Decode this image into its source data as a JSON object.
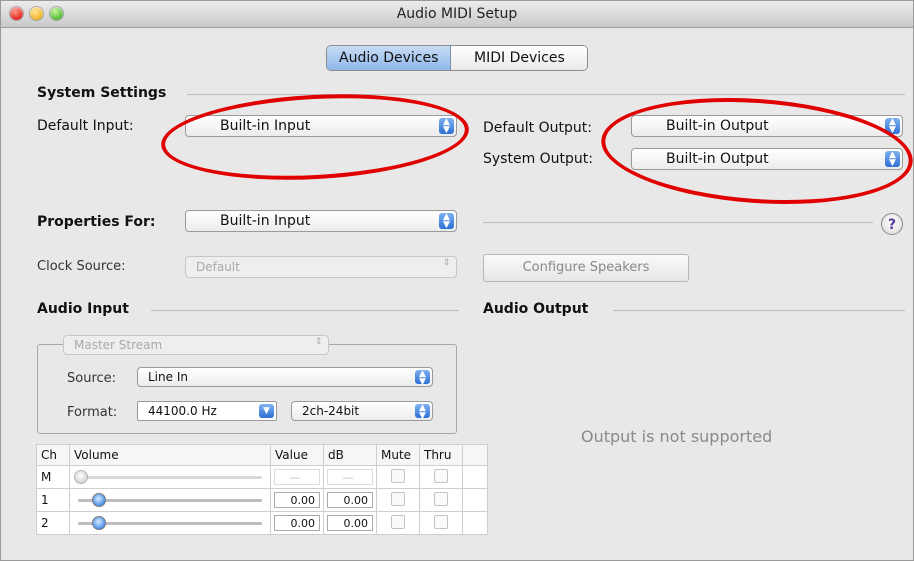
{
  "window": {
    "title": "Audio MIDI Setup"
  },
  "tabs": [
    {
      "label": "Audio Devices"
    },
    {
      "label": "MIDI Devices"
    }
  ],
  "system_settings": {
    "heading": "System Settings",
    "default_input_label": "Default Input:",
    "default_input_value": "Built-in Input",
    "default_output_label": "Default Output:",
    "default_output_value": "Built-in Output",
    "system_output_label": "System Output:",
    "system_output_value": "Built-in Output"
  },
  "properties": {
    "label": "Properties For:",
    "value": "Built-in Input",
    "clock_source_label": "Clock Source:",
    "clock_source_value": "Default",
    "configure_speakers": "Configure Speakers"
  },
  "audio_input": {
    "heading": "Audio Input",
    "stream": "Master Stream",
    "source_label": "Source:",
    "source_value": "Line In",
    "format_label": "Format:",
    "format_rate": "44100.0 Hz",
    "format_bits": "2ch-24bit",
    "table": {
      "headers": [
        "Ch",
        "Volume",
        "Value",
        "dB",
        "Mute",
        "Thru"
      ],
      "rows": [
        {
          "ch": "M",
          "value": "—",
          "db": "—"
        },
        {
          "ch": "1",
          "value": "0.00",
          "db": "0.00"
        },
        {
          "ch": "2",
          "value": "0.00",
          "db": "0.00"
        }
      ]
    }
  },
  "audio_output": {
    "heading": "Audio Output",
    "message": "Output is not supported"
  },
  "help_button": "?",
  "colors": {
    "annotation": "#e00000",
    "tab_active": "#8fb7ea",
    "popup_arrows": "#2f6fd6"
  },
  "icons": [
    "apple-icon",
    "popup-arrows-icon",
    "help-icon"
  ]
}
